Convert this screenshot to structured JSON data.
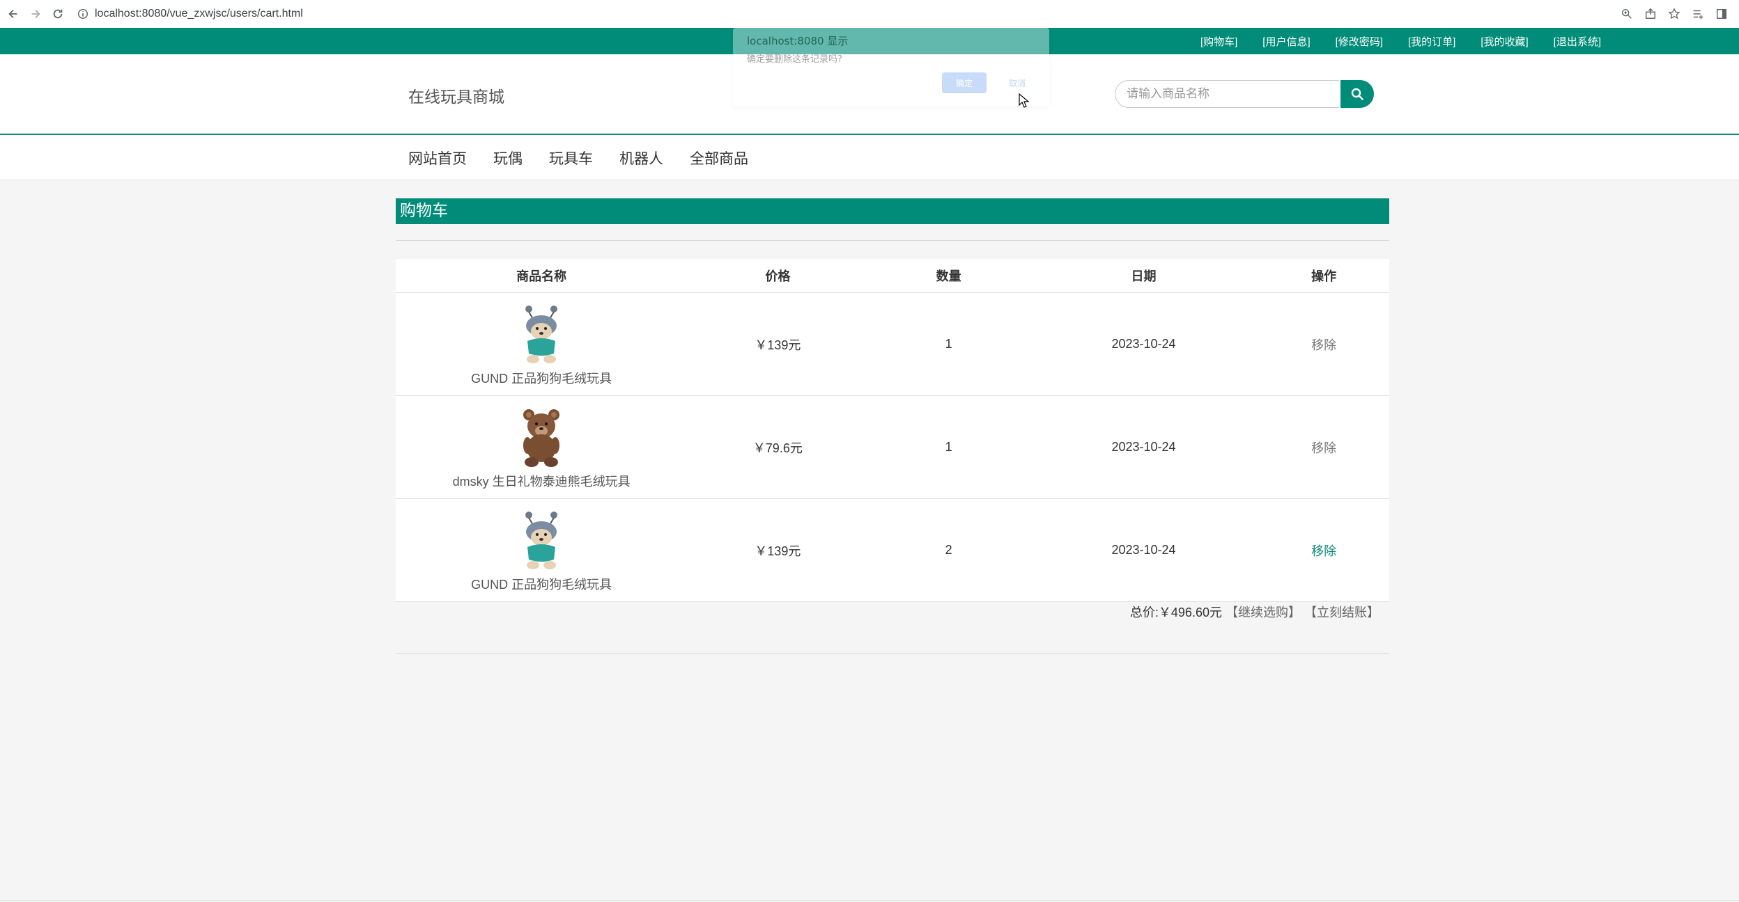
{
  "browser": {
    "url": "localhost:8080/vue_zxwjsc/users/cart.html"
  },
  "topbar": {
    "links": [
      "[购物车]",
      "[用户信息]",
      "[修改密码]",
      "[我的订单]",
      "[我的收藏]",
      "[退出系统]"
    ]
  },
  "header": {
    "site_title": "在线玩具商城",
    "search_placeholder": "请输入商品名称"
  },
  "nav": {
    "items": [
      "网站首页",
      "玩偶",
      "玩具车",
      "机器人",
      "全部商品"
    ]
  },
  "cart": {
    "title": "购物车",
    "columns": [
      "商品名称",
      "价格",
      "数量",
      "日期",
      "操作"
    ],
    "rows": [
      {
        "name": "GUND 正品狗狗毛绒玩具",
        "price": "￥139元",
        "qty": "1",
        "date": "2023-10-24",
        "action": "移除",
        "image": "dog-plush"
      },
      {
        "name": "dmsky 生日礼物泰迪熊毛绒玩具",
        "price": "￥79.6元",
        "qty": "1",
        "date": "2023-10-24",
        "action": "移除",
        "image": "teddy-bear"
      },
      {
        "name": "GUND 正品狗狗毛绒玩具",
        "price": "￥139元",
        "qty": "2",
        "date": "2023-10-24",
        "action": "移除",
        "image": "dog-plush"
      }
    ],
    "total_label": "总价:￥496.60元",
    "continue_label": "【继续选购】",
    "checkout_label": "【立刻结账】"
  },
  "dialog": {
    "title": "localhost:8080 显示",
    "message": "确定要删除这条记录吗?",
    "ok_label": "确定",
    "cancel_label": "取消"
  },
  "colors": {
    "brand": "#008c78",
    "background": "#f5f5f5"
  }
}
